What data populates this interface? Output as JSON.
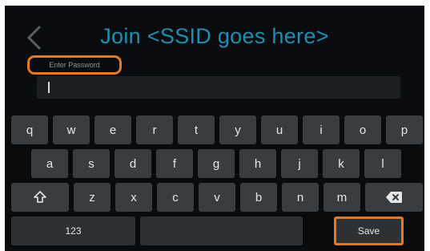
{
  "header": {
    "title": "Join <SSID goes here>",
    "password_label": "Enter Password",
    "password_value": ""
  },
  "keyboard": {
    "rows": [
      [
        "q",
        "w",
        "e",
        "r",
        "t",
        "y",
        "u",
        "i",
        "o",
        "p"
      ],
      [
        "a",
        "s",
        "d",
        "f",
        "g",
        "h",
        "j",
        "k",
        "l"
      ],
      [
        "z",
        "x",
        "c",
        "v",
        "b",
        "n",
        "m"
      ]
    ],
    "mode_label": "123",
    "save_label": "Save"
  },
  "icons": {
    "back": "chevron-left-icon",
    "shift": "shift-icon",
    "backspace": "backspace-icon"
  },
  "colors": {
    "accent_title": "#1f8fb0",
    "highlight": "#e07a2a",
    "key": "#3a3d40",
    "background": "#0b0d10"
  }
}
